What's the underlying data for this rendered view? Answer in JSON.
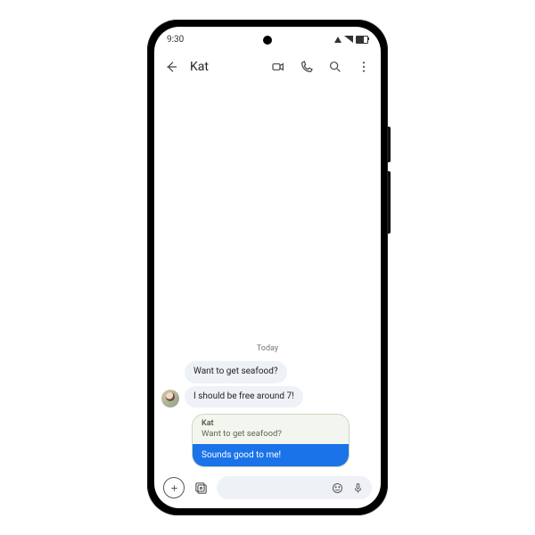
{
  "status": {
    "time": "9:30"
  },
  "header": {
    "title": "Kat"
  },
  "thread": {
    "date": "Today",
    "messages": [
      {
        "sender": "Kat",
        "text": "Want to get seafood?"
      },
      {
        "sender": "Kat",
        "text": "I should be free around 7!"
      }
    ],
    "reply": {
      "quoted_sender": "Kat",
      "quoted_text": "Want to get seafood?",
      "text": "Sounds good to me!"
    }
  },
  "colors": {
    "incoming_bubble": "#eef1f6",
    "outgoing_bubble": "#1a73e8",
    "reply_card_border": "#c9d7c0",
    "reply_card_bg": "#f2f6ee"
  }
}
